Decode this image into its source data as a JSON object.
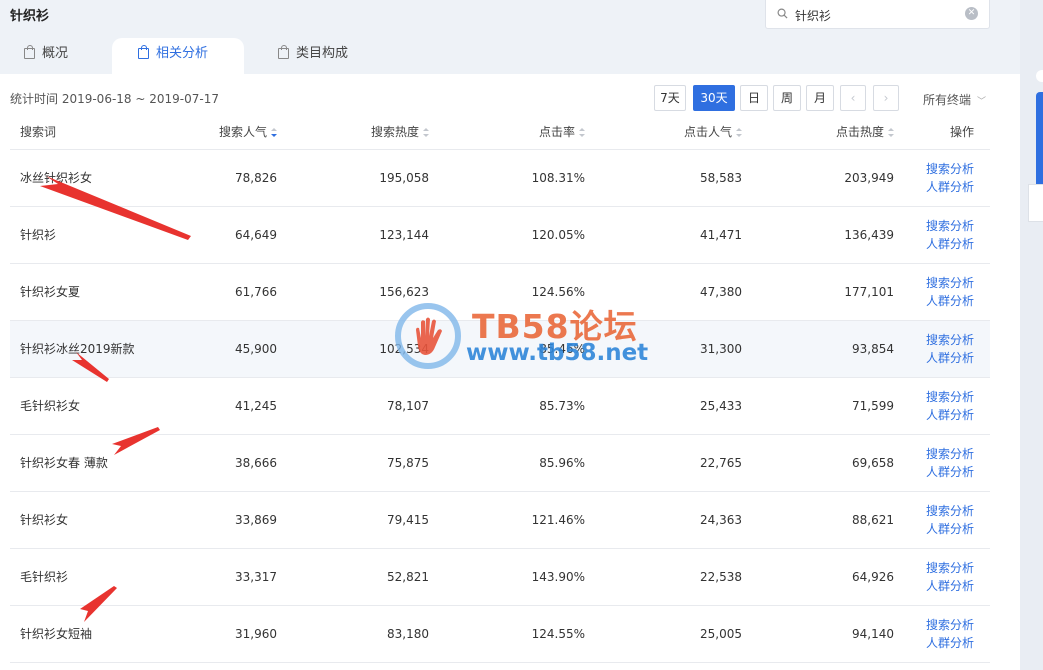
{
  "page": {
    "title": "针织衫"
  },
  "search": {
    "value": "针织衫"
  },
  "tabs": [
    {
      "label": "概况"
    },
    {
      "label": "相关分析",
      "active": true
    },
    {
      "label": "类目构成"
    }
  ],
  "stats": {
    "range_text": "统计时间 2019-06-18 ~ 2019-07-17"
  },
  "period_buttons": [
    {
      "label": "7天"
    },
    {
      "label": "30天",
      "selected": true
    },
    {
      "label": "日"
    },
    {
      "label": "周"
    },
    {
      "label": "月"
    }
  ],
  "nav": {
    "prev": "‹",
    "next": "›"
  },
  "terminal": {
    "label": "所有终端"
  },
  "table": {
    "headers": [
      "搜索词",
      "搜索人气",
      "搜索热度",
      "点击率",
      "点击人气",
      "点击热度",
      "操作"
    ],
    "sort_active_column": "搜索人气",
    "rows": [
      {
        "term": "冰丝针织衫女",
        "search_pop": "78,826",
        "search_heat": "195,058",
        "ctr": "108.31%",
        "click_pop": "58,583",
        "click_heat": "203,949"
      },
      {
        "term": "针织衫",
        "search_pop": "64,649",
        "search_heat": "123,144",
        "ctr": "120.05%",
        "click_pop": "41,471",
        "click_heat": "136,439"
      },
      {
        "term": "针织衫女夏",
        "search_pop": "61,766",
        "search_heat": "156,623",
        "ctr": "124.56%",
        "click_pop": "47,380",
        "click_heat": "177,101"
      },
      {
        "term": "针织衫冰丝2019新款",
        "search_pop": "45,900",
        "search_heat": "102,534",
        "ctr": "85.46%",
        "click_pop": "31,300",
        "click_heat": "93,854"
      },
      {
        "term": "毛针织衫女",
        "search_pop": "41,245",
        "search_heat": "78,107",
        "ctr": "85.73%",
        "click_pop": "25,433",
        "click_heat": "71,599"
      },
      {
        "term": "针织衫女春 薄款",
        "search_pop": "38,666",
        "search_heat": "75,875",
        "ctr": "85.96%",
        "click_pop": "22,765",
        "click_heat": "69,658"
      },
      {
        "term": "针织衫女",
        "search_pop": "33,869",
        "search_heat": "79,415",
        "ctr": "121.46%",
        "click_pop": "24,363",
        "click_heat": "88,621"
      },
      {
        "term": "毛针织衫",
        "search_pop": "33,317",
        "search_heat": "52,821",
        "ctr": "143.90%",
        "click_pop": "22,538",
        "click_heat": "64,926"
      },
      {
        "term": "针织衫女短袖",
        "search_pop": "31,960",
        "search_heat": "83,180",
        "ctr": "124.55%",
        "click_pop": "25,005",
        "click_heat": "94,140"
      }
    ],
    "action_search": "搜索分析",
    "action_crowd": "人群分析"
  },
  "watermark": {
    "name": "TB58论坛",
    "url": "www.tb58.net"
  },
  "colors": {
    "accent": "#2f6fe0",
    "annotation": "#e8332f",
    "watermark_orange": "#ea6a3c",
    "watermark_blue": "#2f86d9"
  }
}
